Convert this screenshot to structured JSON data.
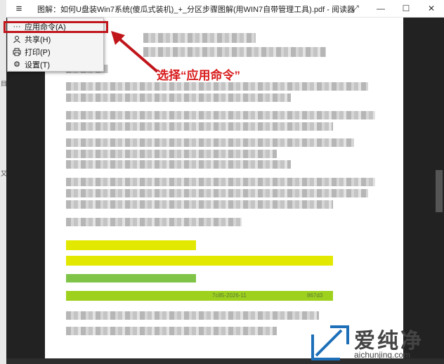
{
  "window": {
    "title": "图解：如何U盘装Win7系统(傻瓜式装机)_+_分区步骤图解(用WIN7自带管理工具).pdf - 阅读器",
    "menu_icon": "hamburger-icon",
    "controls": {
      "expand": "⤢",
      "minimize": "—",
      "maximize": "☐",
      "close": "✕"
    }
  },
  "menu": {
    "items": [
      {
        "icon": "more-dots-icon",
        "label": "应用命令(A)"
      },
      {
        "icon": "share-icon",
        "label": "共享(H)"
      },
      {
        "icon": "printer-icon",
        "label": "打印(P)"
      },
      {
        "icon": "gear-icon",
        "label": "设置(T)"
      }
    ]
  },
  "annotation": {
    "text": "选择“应用命令”",
    "color": "#d81b1b"
  },
  "document": {
    "visible_fragments": {
      "code": "7c85-2026-11",
      "code_tail": "867d3"
    }
  },
  "watermark": {
    "brand": "爱纯净",
    "url": "aichunjing.com"
  },
  "colors": {
    "highlight_yellow": "#e2e800",
    "highlight_green": "#9ed11e",
    "accent_red": "#c0151b"
  }
}
